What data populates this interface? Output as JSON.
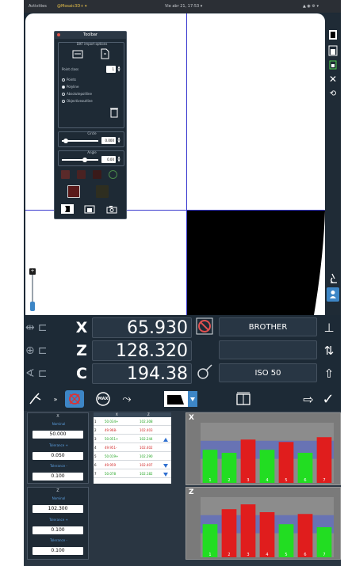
{
  "topbar": {
    "left": "Activities",
    "app": "@Mosaic3D+ ▾",
    "clock": "Vie abr 21, 17:53 ▾",
    "right": "▲ ◉ ⚙ ▾"
  },
  "panel": {
    "title": "Toolbar",
    "group1_title": "DXF import options",
    "point_label": "Point class",
    "point_value": "1",
    "radio_labels": [
      "Points",
      "Polyline",
      "Absolutepoliline",
      "Objectiveoutline"
    ],
    "group2_title": "Circle",
    "circle_value": "0.000",
    "group3_title": "Angle",
    "angle_value": "0.00"
  },
  "dro": {
    "x_axis": "X",
    "x_value": "65.930",
    "x_tool": "BROTHER",
    "z_axis": "Z",
    "z_value": "128.320",
    "z_tool": "",
    "c_axis": "C",
    "c_value": "194.38",
    "c_tool": "ISO 50"
  },
  "toolbar": {
    "max_label": "MAX"
  },
  "left_params": {
    "x_title": "X",
    "x_fields": [
      {
        "label": "Nominal",
        "value": "50.000"
      },
      {
        "label": "Tolerance +",
        "value": "0.050"
      },
      {
        "label": "Tolerance -",
        "value": "0.100"
      }
    ],
    "z_title": "Z",
    "z_fields": [
      {
        "label": "Nominal",
        "value": "102.300"
      },
      {
        "label": "Tolerance +",
        "value": "0.100"
      },
      {
        "label": "Tolerance -",
        "value": "0.100"
      }
    ]
  },
  "table": {
    "headers": [
      "X",
      "Z"
    ],
    "rows": [
      {
        "idx": "1",
        "x": "50.034+",
        "z": "102.308",
        "flag": ""
      },
      {
        "idx": "2",
        "x": "49.968-",
        "z": "102.403",
        "flag": ""
      },
      {
        "idx": "3",
        "x": "50.051+",
        "z": "102.244",
        "flag": "up"
      },
      {
        "idx": "4",
        "x": "49.951-",
        "z": "102.402",
        "flag": ""
      },
      {
        "idx": "5",
        "x": "50.019+",
        "z": "102.290",
        "flag": ""
      },
      {
        "idx": "6",
        "x": "49.959",
        "z": "102.407",
        "flag": "down"
      },
      {
        "idx": "7",
        "x": "50.078",
        "z": "102.182",
        "flag": "down"
      }
    ]
  },
  "chart_data": [
    {
      "type": "bar",
      "label": "X",
      "categories": [
        "1",
        "2",
        "3",
        "4",
        "5",
        "6",
        "7"
      ],
      "values": [
        0.55,
        0.5,
        0.72,
        0.55,
        0.68,
        0.5,
        0.76
      ],
      "status": [
        "ok",
        "ok",
        "out",
        "ok",
        "out",
        "ok",
        "out"
      ],
      "colors": {
        "ok": "#22dd22",
        "out": "#e01d1d",
        "band": "#4a5fd6"
      }
    },
    {
      "type": "bar",
      "label": "Z",
      "categories": [
        "1",
        "2",
        "3",
        "4",
        "5",
        "6",
        "7"
      ],
      "values": [
        0.55,
        0.8,
        0.88,
        0.75,
        0.55,
        0.72,
        0.5
      ],
      "status": [
        "ok",
        "out",
        "out",
        "out",
        "ok",
        "out",
        "ok"
      ],
      "colors": {
        "ok": "#22dd22",
        "out": "#e01d1d",
        "band": "#4a5fd6"
      }
    }
  ]
}
